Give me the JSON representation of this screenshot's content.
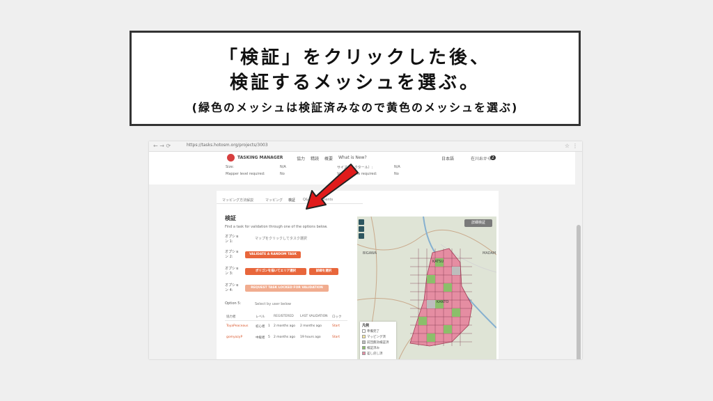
{
  "callout": {
    "line1": "「検証」をクリックした後、",
    "line2": "検証するメッシュを選ぶ。",
    "line3": "(緑色のメッシュは検証済みなので黄色のメッシュを選ぶ)"
  },
  "browser": {
    "url": "https://tasks.hotosm.org/projects/3003",
    "back_icon": "back-arrow-icon",
    "star_icon": "star-icon",
    "menu_icon": "kebab-menu-icon"
  },
  "app": {
    "brand": "TASKING MANAGER",
    "nav": [
      "協力",
      "精読",
      "概要",
      "What is New?"
    ],
    "language": "日本語",
    "user": "在川おから",
    "notifications": "2"
  },
  "prev_section": {
    "rows": [
      {
        "label": "Size:",
        "value": "N/A",
        "label2": "サイズ（ヘクタール）:",
        "value2": "N/A"
      },
      {
        "label": "Mapper level required:",
        "value": "No",
        "label2": "Validator role required:",
        "value2": "No"
      }
    ]
  },
  "tabs": [
    "マッピング方法解説",
    "マッピング",
    "検証",
    "Q&A",
    "Comments"
  ],
  "panel": {
    "title": "検証",
    "description": "Find a task for validation through one of the options below.",
    "options": [
      {
        "label": "オプション 1:",
        "text": "マップをクリックしてタスク選択"
      },
      {
        "label": "オプション 2:",
        "button": "VALIDATE A RANDOM TASK"
      },
      {
        "label": "オプション 3:",
        "button": "ポリゴンを描いてエリア選択",
        "button2": "詳細を選択"
      },
      {
        "label": "オプション 4:",
        "button": "REQUEST TASK LOCKED FOR VALIDATION"
      },
      {
        "label": "Option 5:",
        "text": "Select by user below"
      }
    ]
  },
  "table": {
    "headers": [
      "協力者",
      "レベル",
      "REGISTERED",
      "LAST VALIDATION",
      "ロック"
    ],
    "rows": [
      {
        "user": "ToyaPeaceaus",
        "level": "初心者",
        "num": "1",
        "registered": "2 months ago",
        "last": "2 months ago",
        "lock": "Start"
      },
      {
        "user": "gomyazyP",
        "level": "中級者",
        "num": "5",
        "registered": "2 months ago",
        "last": "19 hours ago",
        "lock": "Start"
      }
    ]
  },
  "map": {
    "detail_button": "詳細検証",
    "labels": [
      "BIGAWA",
      "MADAM",
      "KATSU",
      "KANTO"
    ],
    "legend": {
      "title": "凡例",
      "items": [
        {
          "label": "準備完了",
          "color": "#ffffff"
        },
        {
          "label": "マッピング済",
          "color": "#fde8a0"
        },
        {
          "label": "前回無効検証済",
          "color": "#bdbdbd"
        },
        {
          "label": "検証済み",
          "color": "#8bbf6a"
        },
        {
          "label": "差し戻し済",
          "color": "#e58da2"
        }
      ]
    }
  },
  "colors": {
    "accent": "#e8663b",
    "arrow": "#e01b1b",
    "validated": "#8bbf6a",
    "mapped": "#e58da2"
  }
}
